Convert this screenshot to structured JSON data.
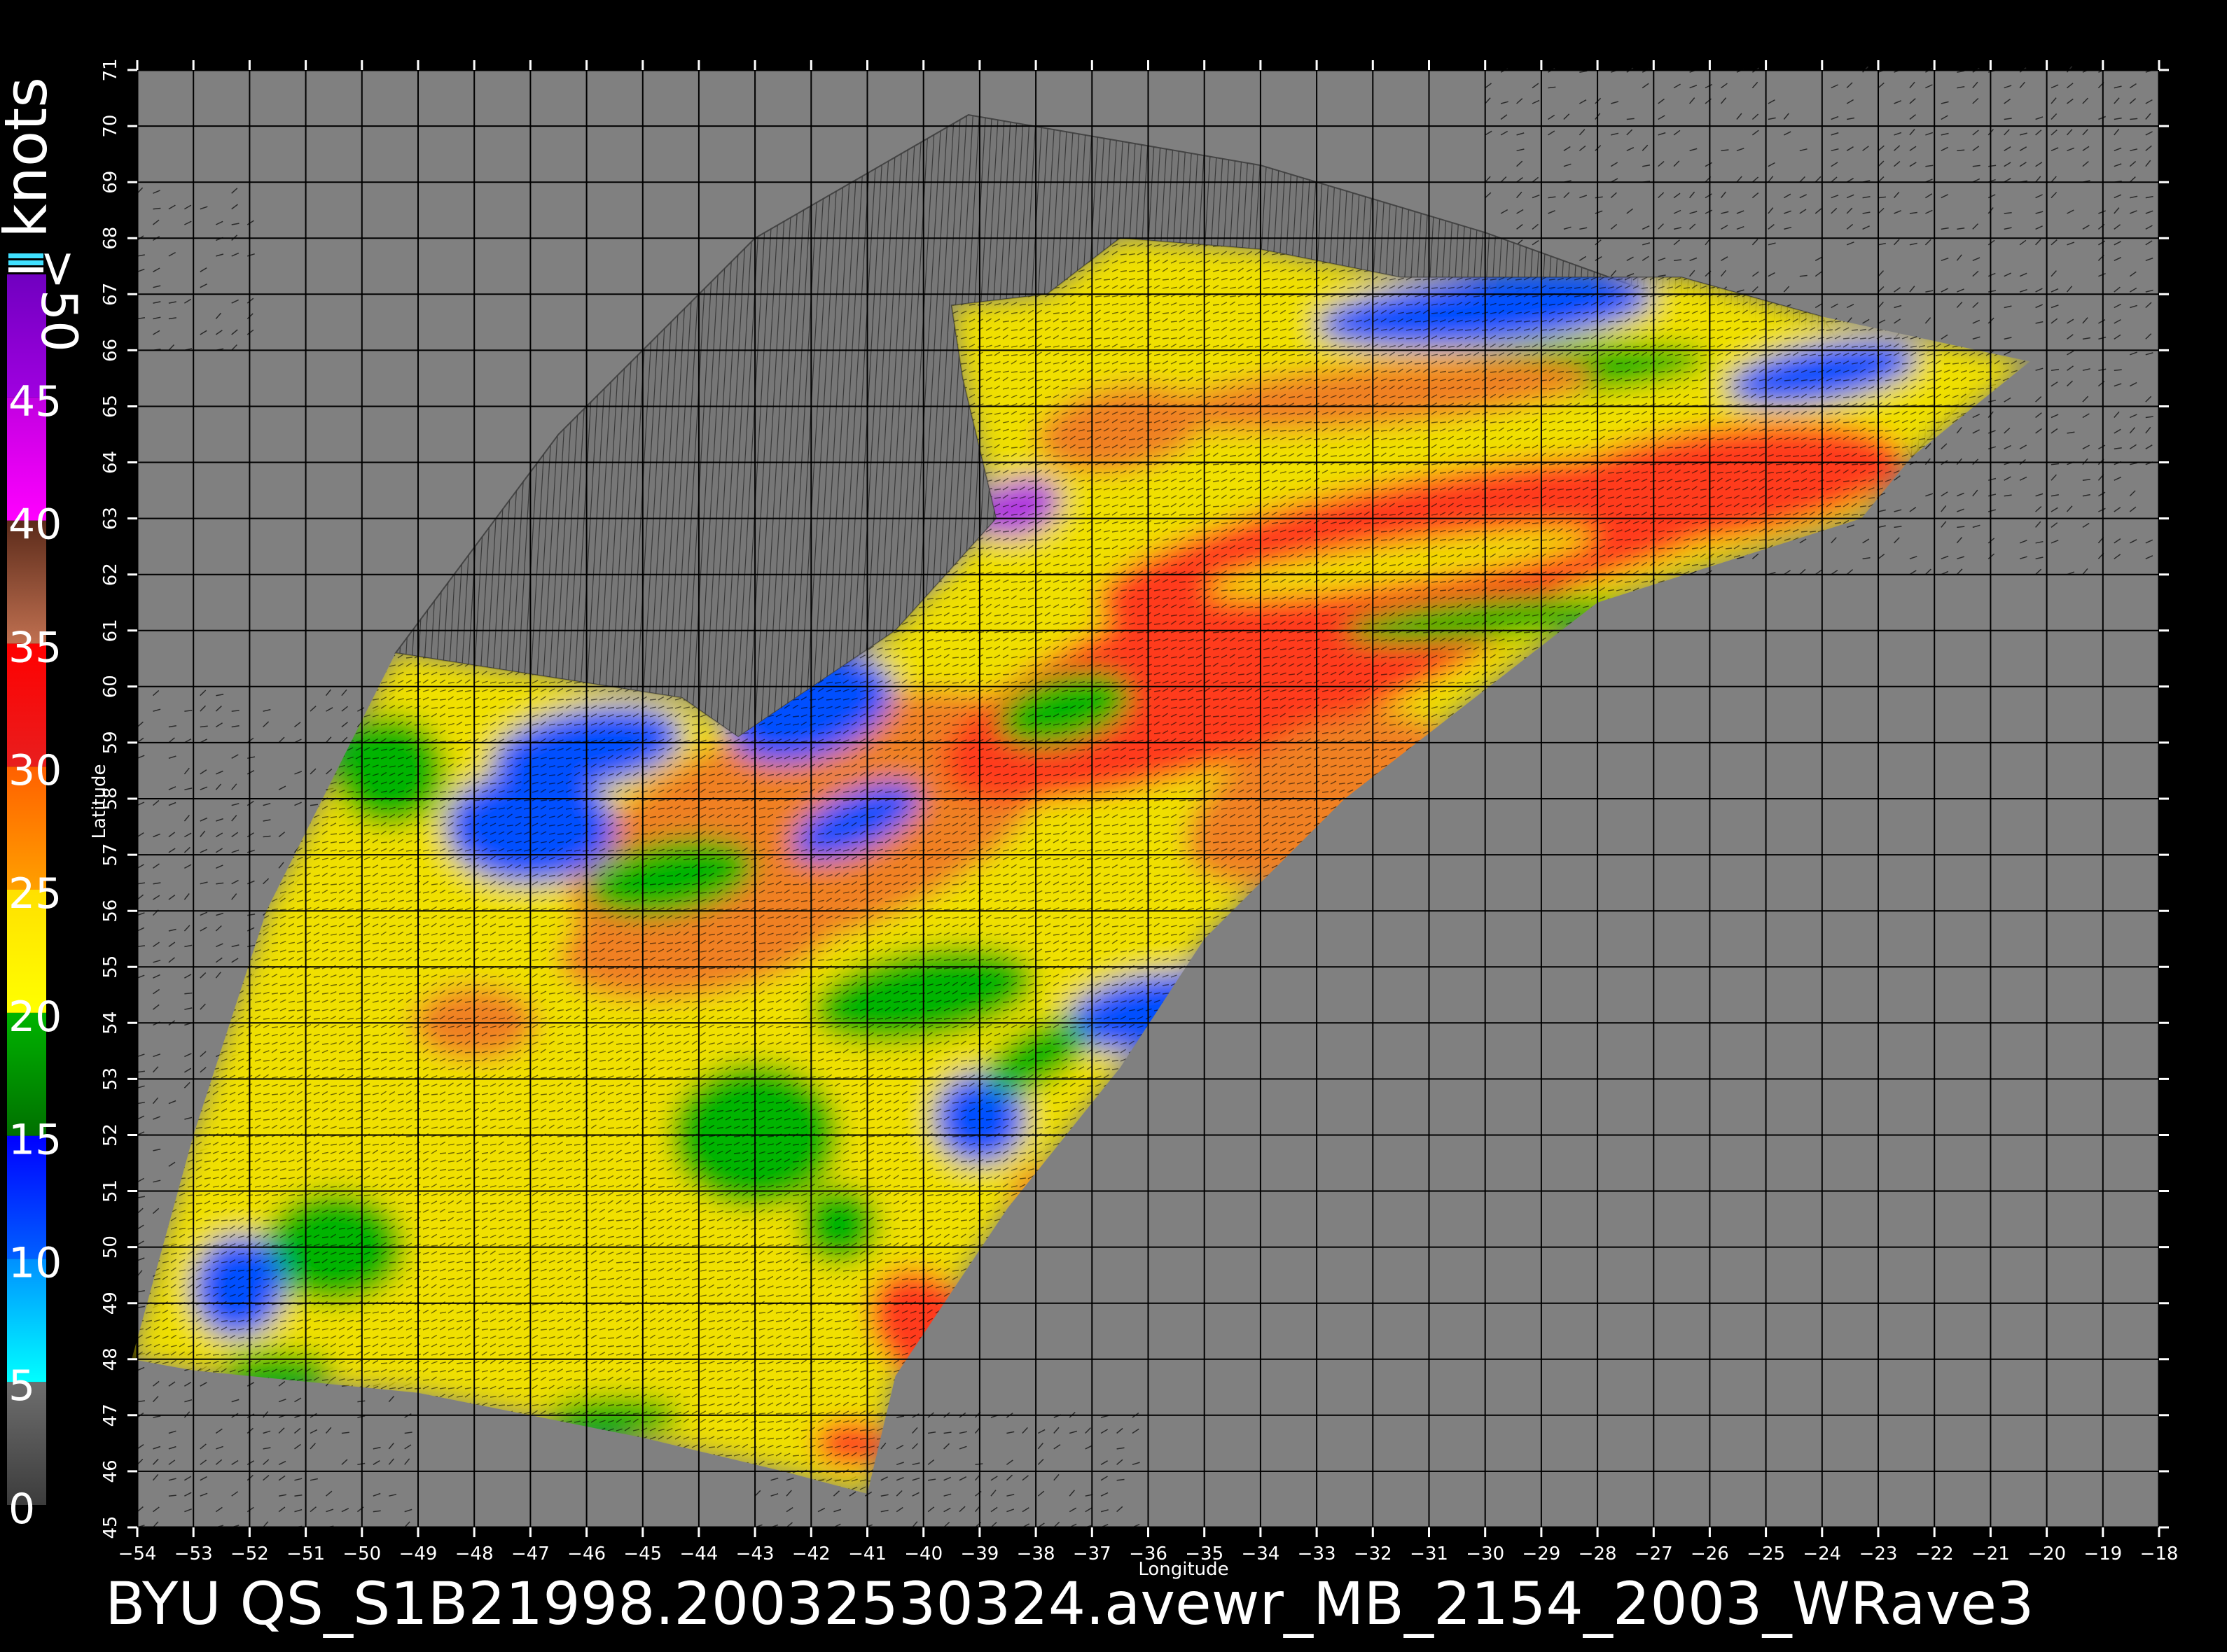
{
  "map": {
    "caption": "BYU  QS_S1B21998.20032530324.avewr_MB_2154_2003_WRave3",
    "x_axis_label": "Longitude",
    "y_axis_label": "Latitude",
    "longitudes": [
      -54,
      -53,
      -52,
      -51,
      -50,
      -49,
      -48,
      -47,
      -46,
      -45,
      -44,
      -43,
      -42,
      -41,
      -40,
      -39,
      -38,
      -37,
      -36,
      -35,
      -34,
      -33,
      -32,
      -31,
      -30,
      -29,
      -28,
      -27,
      -26,
      -25,
      -24,
      -23,
      -22,
      -21,
      -20,
      -19,
      -18
    ],
    "latitudes": [
      45,
      46,
      47,
      48,
      49,
      50,
      51,
      52,
      53,
      54,
      55,
      56,
      57,
      58,
      59,
      60,
      61,
      62,
      63,
      64,
      65,
      66,
      67,
      68,
      69,
      70,
      71
    ],
    "background_color": "#808080",
    "grid_color": "#000000"
  },
  "legend": {
    "unit": "knots",
    "over_label": ">50",
    "ticks": [
      "0",
      "5",
      "10",
      "15",
      "20",
      "25",
      "30",
      "35",
      "40",
      "45"
    ],
    "bands": [
      {
        "from": 0,
        "to": 5,
        "top": "#6e6e6e",
        "bottom": "#3c3c3c"
      },
      {
        "from": 5,
        "to": 10,
        "top": "#0090ff",
        "bottom": "#00ffff"
      },
      {
        "from": 10,
        "to": 15,
        "top": "#0000ff",
        "bottom": "#0060ff"
      },
      {
        "from": 15,
        "to": 20,
        "top": "#00b400",
        "bottom": "#007000"
      },
      {
        "from": 20,
        "to": 25,
        "top": "#ffe000",
        "bottom": "#ffff00"
      },
      {
        "from": 25,
        "to": 30,
        "top": "#ff6000",
        "bottom": "#ffa000"
      },
      {
        "from": 30,
        "to": 35,
        "top": "#ff0000",
        "bottom": "#e81e1e"
      },
      {
        "from": 35,
        "to": 40,
        "top": "#5a2a1a",
        "bottom": "#c07050"
      },
      {
        "from": 40,
        "to": 45,
        "top": "#c000e0",
        "bottom": "#ff00ff"
      },
      {
        "from": 45,
        "to": 50,
        "top": "#7000c0",
        "bottom": "#a000e0"
      }
    ],
    "speed_colors": {
      "blue": "#0050ff",
      "green": "#00b400",
      "yellow": "#f0e000",
      "orange": "#f08020",
      "red": "#ff3a1a",
      "purple": "#b030e0"
    }
  }
}
